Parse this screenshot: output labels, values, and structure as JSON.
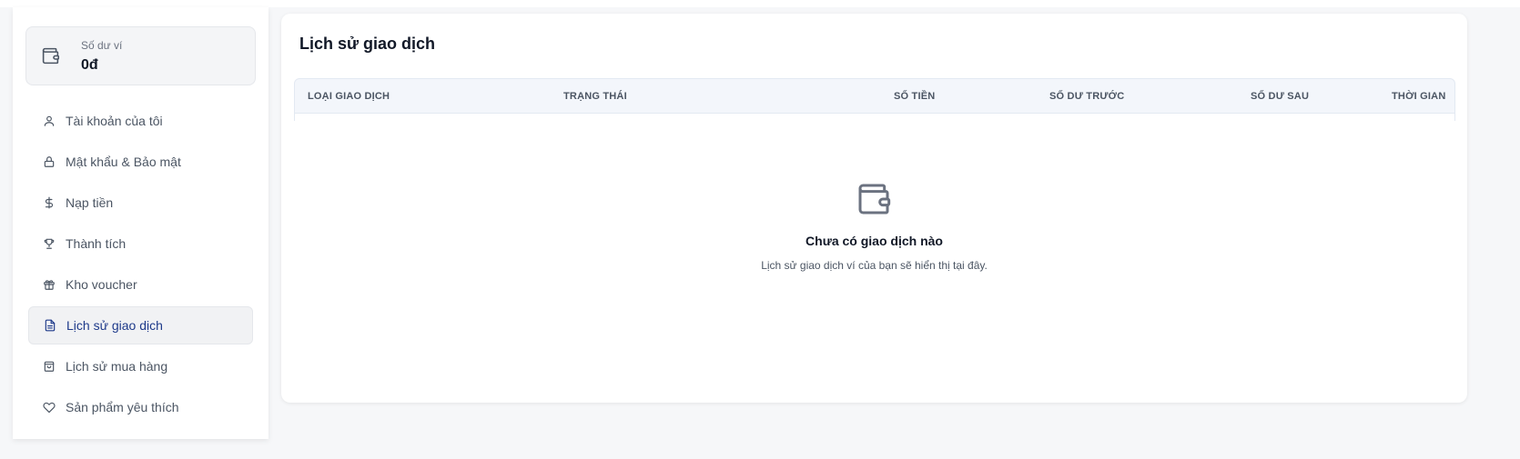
{
  "wallet": {
    "label": "Số dư ví",
    "value": "0đ",
    "icon": "wallet-icon"
  },
  "sidebar": {
    "items": [
      {
        "label": "Tài khoản của tôi",
        "icon": "user-icon",
        "active": false
      },
      {
        "label": "Mật khẩu & Bảo mật",
        "icon": "lock-icon",
        "active": false
      },
      {
        "label": "Nạp tiền",
        "icon": "dollar-icon",
        "active": false
      },
      {
        "label": "Thành tích",
        "icon": "trophy-icon",
        "active": false
      },
      {
        "label": "Kho voucher",
        "icon": "gift-icon",
        "active": false
      },
      {
        "label": "Lịch sử giao dịch",
        "icon": "document-icon",
        "active": true
      },
      {
        "label": "Lịch sử mua hàng",
        "icon": "shopping-bag-icon",
        "active": false
      },
      {
        "label": "Sản phẩm yêu thích",
        "icon": "heart-icon",
        "active": false
      }
    ]
  },
  "main": {
    "title": "Lịch sử giao dịch",
    "columns": [
      "LOẠI GIAO DỊCH",
      "TRẠNG THÁI",
      "SỐ TIỀN",
      "SỐ DƯ TRƯỚC",
      "SỐ DƯ SAU",
      "THỜI GIAN"
    ],
    "empty": {
      "title": "Chưa có giao dịch nào",
      "subtitle": "Lịch sử giao dịch ví của bạn sẽ hiển thị tại đây.",
      "icon": "wallet-icon"
    }
  },
  "colors": {
    "accent": "#1e3a8a",
    "background": "#f6f7f9",
    "table_header": "#f3f6fb"
  }
}
